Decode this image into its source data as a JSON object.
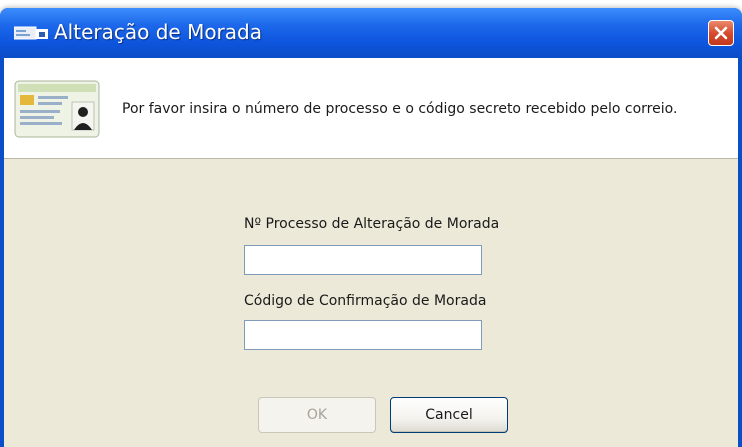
{
  "window": {
    "title": "Alteração de Morada",
    "title_icon": "address-card-icon",
    "close_icon": "close-icon"
  },
  "header": {
    "icon": "id-card-icon",
    "instruction": "Por favor insira o número de processo e o código secreto recebido pelo correio."
  },
  "form": {
    "process_label": "Nº Processo de Alteração de Morada",
    "process_value": "",
    "code_label": "Código de Confirmação de Morada",
    "code_value": ""
  },
  "buttons": {
    "ok_label": "OK",
    "ok_enabled": false,
    "cancel_label": "Cancel"
  },
  "colors": {
    "titlebar": "#0d55dd",
    "close_button": "#d5482b",
    "dialog_body": "#ece9d8",
    "input_border": "#7f9db9"
  }
}
